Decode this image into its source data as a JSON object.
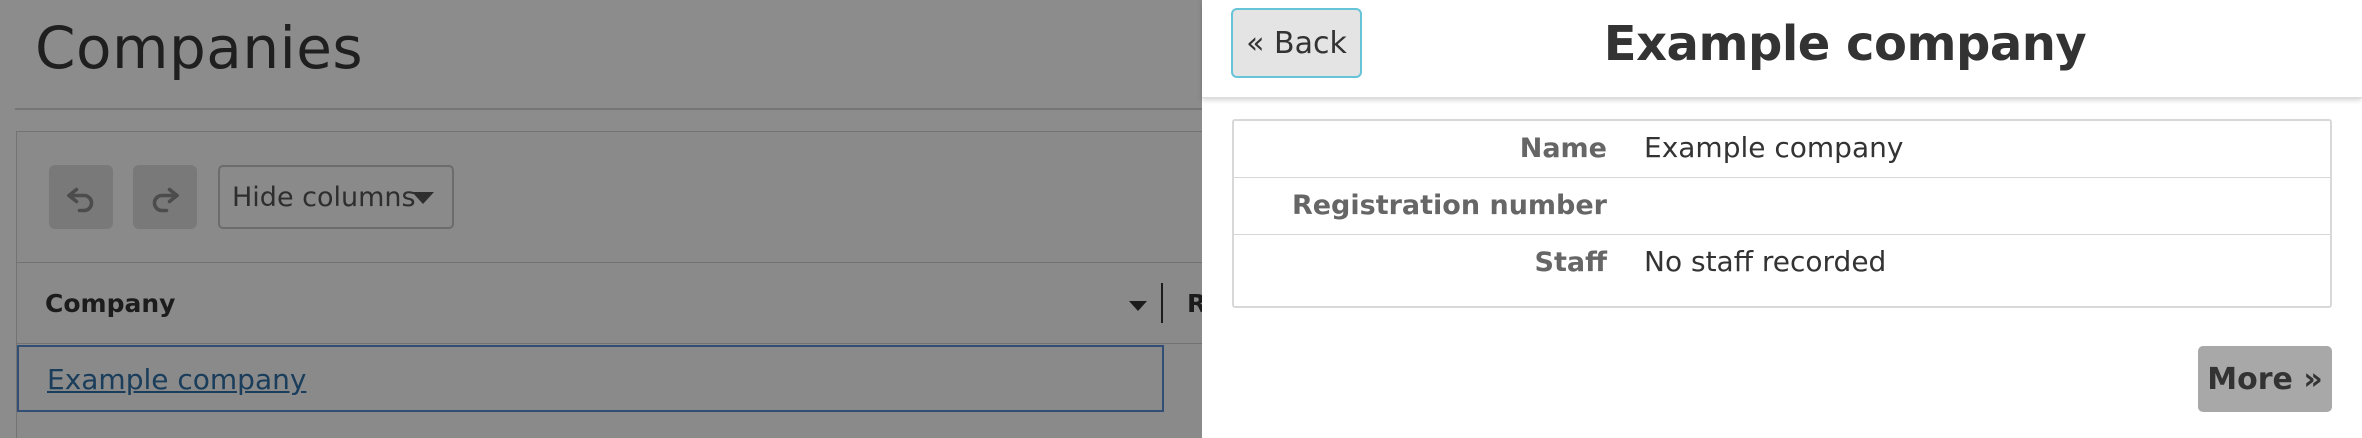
{
  "background": {
    "page_title": "Companies",
    "toolbar": {
      "undo_icon": "undo-icon",
      "redo_icon": "redo-icon",
      "hide_columns_label": "Hide columns"
    },
    "grid": {
      "columns": [
        "Company",
        "R"
      ],
      "rows": [
        {
          "company": "Example company"
        }
      ]
    }
  },
  "drawer": {
    "back_label": "« Back",
    "title": "Example company",
    "fields": [
      {
        "label": "Name",
        "value": "Example company"
      },
      {
        "label": "Registration number",
        "value": ""
      },
      {
        "label": "Staff",
        "value": "No staff recorded"
      }
    ],
    "more_label": "More »"
  },
  "colors": {
    "overlay": "#000000",
    "link": "#2f6fa7",
    "selection_border": "#5b8ed6",
    "back_focus_border": "#67c4d8",
    "more_button": "#a8a8a8"
  }
}
